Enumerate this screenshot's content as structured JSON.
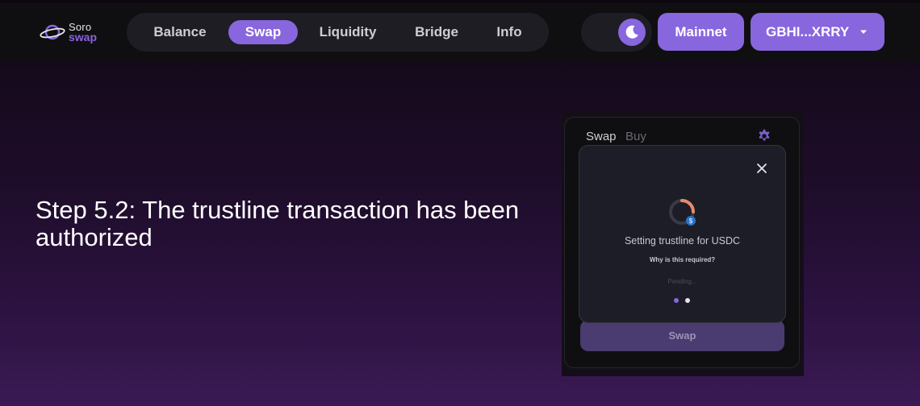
{
  "brand": {
    "line1": "Soro",
    "line2": "swap"
  },
  "nav": {
    "items": [
      {
        "label": "Balance"
      },
      {
        "label": "Swap"
      },
      {
        "label": "Liquidity"
      },
      {
        "label": "Bridge"
      },
      {
        "label": "Info"
      }
    ],
    "active": "Swap"
  },
  "theme_toggle": {
    "icon": "moon-icon",
    "mode": "dark"
  },
  "network_button": {
    "label": "Mainnet"
  },
  "wallet_button": {
    "label": "GBHI...XRRY",
    "icon": "caret-down-icon"
  },
  "headline": "Step 5.2: The trustline transaction has been authorized",
  "swap_card": {
    "tabs": [
      {
        "label": "Swap"
      },
      {
        "label": "Buy"
      }
    ],
    "settings_icon": "gear-icon",
    "swap_button_label": "Swap"
  },
  "modal": {
    "title": "Setting trustline for USDC",
    "why_link": "Why is this required?",
    "status": "Pending...",
    "close_icon": "close-icon",
    "step_dots": {
      "count": 2,
      "current": 1
    }
  },
  "colors": {
    "accent": "#8866dd",
    "nav_bg": "#1e1d24",
    "topbar_bg": "#0f0f12",
    "modal_bg": "#1c1d26",
    "spinner_arc": "#e88a6a",
    "usdc_badge": "#2775ca"
  }
}
